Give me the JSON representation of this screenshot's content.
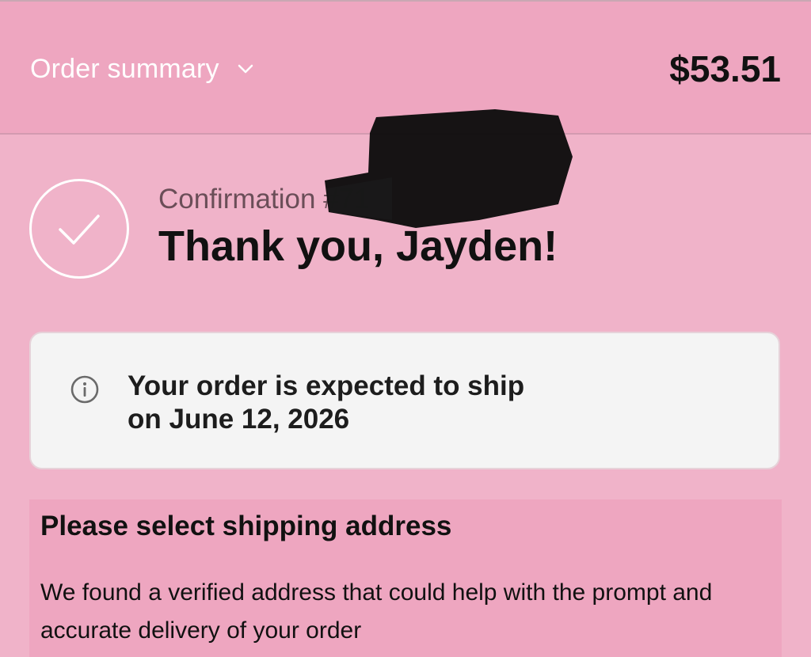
{
  "header": {
    "summary_label": "Order summary",
    "total": "$53.51"
  },
  "confirmation": {
    "number_label": "Confirmation #71",
    "thank_you": "Thank you, Jayden!"
  },
  "notice": {
    "line1": "Your order is expected to ship",
    "line2": "on June 12, 2026",
    "icon": "info-icon"
  },
  "shipping": {
    "title": "Please select shipping address",
    "body": "We found a verified address that could help with the prompt and accurate delivery of your order"
  },
  "colors": {
    "background": "#f0b3c9",
    "header": "#eea6c0",
    "notice_bg": "#f4f4f4"
  }
}
